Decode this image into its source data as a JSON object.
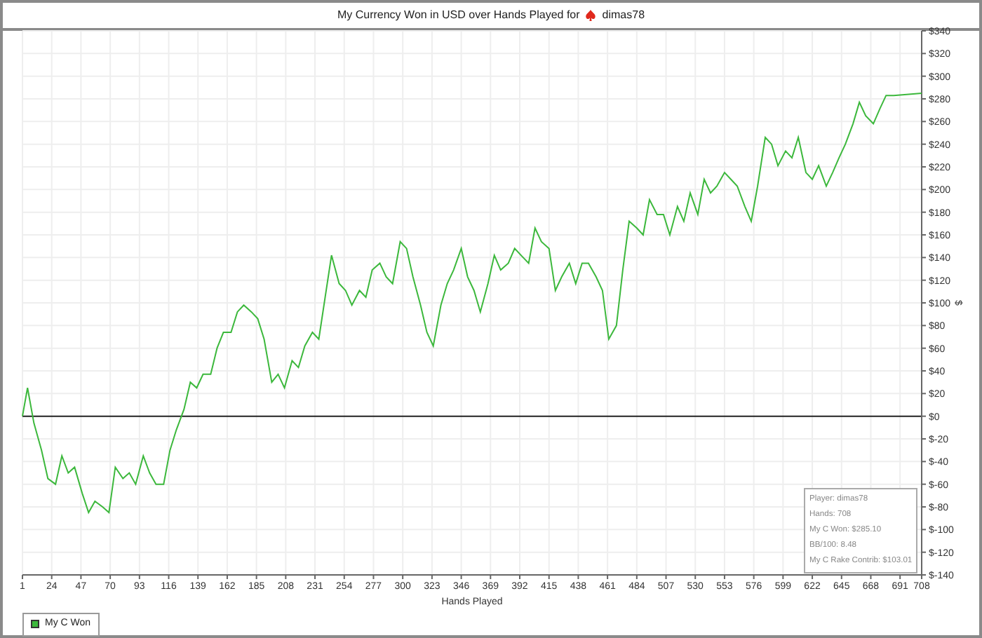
{
  "title_bar": {
    "text": "My Currency Won in USD over Hands Played for",
    "player": "dimas78"
  },
  "chart": {
    "chart_data": {
      "type": "line",
      "grid": true,
      "xlabel": "Hands Played",
      "ylabel": "$",
      "x": [
        1,
        5,
        10,
        16,
        21,
        27,
        32,
        37,
        42,
        48,
        53,
        58,
        64,
        69,
        74,
        80,
        85,
        90,
        96,
        101,
        106,
        112,
        117,
        122,
        128,
        133,
        138,
        143,
        149,
        154,
        159,
        165,
        170,
        175,
        181,
        186,
        191,
        197,
        202,
        207,
        213,
        218,
        223,
        229,
        234,
        239,
        244,
        250,
        255,
        260,
        266,
        271,
        276,
        282,
        287,
        292,
        298,
        303,
        308,
        314,
        319,
        324,
        330,
        335,
        340,
        346,
        351,
        356,
        361,
        367,
        372,
        377,
        383,
        388,
        393,
        399,
        404,
        409,
        415,
        420,
        425,
        431,
        436,
        441,
        446,
        452,
        457,
        462,
        468,
        473,
        478,
        484,
        489,
        494,
        500,
        505,
        510,
        516,
        521,
        526,
        532,
        537,
        542,
        547,
        553,
        558,
        563,
        569,
        574,
        579,
        585,
        590,
        595,
        601,
        606,
        611,
        617,
        622,
        627,
        633,
        638,
        643,
        648,
        654,
        659,
        664,
        670,
        675,
        680,
        686,
        708
      ],
      "series": [
        {
          "name": "My C Won",
          "color": "#3cb83c",
          "values": [
            0,
            25,
            -6,
            -30,
            -55,
            -60,
            -35,
            -50,
            -45,
            -68,
            -85,
            -75,
            -80,
            -85,
            -45,
            -55,
            -50,
            -60,
            -35,
            -50,
            -60,
            -60,
            -30,
            -12,
            6,
            30,
            25,
            37,
            37,
            60,
            74,
            74,
            92,
            98,
            92,
            86,
            68,
            30,
            37,
            25,
            49,
            43,
            62,
            74,
            68,
            105,
            142,
            117,
            111,
            98,
            111,
            105,
            129,
            135,
            123,
            117,
            154,
            148,
            123,
            98,
            74,
            62,
            98,
            117,
            129,
            148,
            123,
            111,
            92,
            117,
            142,
            129,
            135,
            148,
            142,
            135,
            166,
            154,
            148,
            111,
            123,
            135,
            117,
            135,
            135,
            123,
            111,
            68,
            80,
            129,
            172,
            166,
            160,
            191,
            178,
            178,
            160,
            185,
            172,
            197,
            178,
            209,
            197,
            203,
            215,
            209,
            203,
            185,
            172,
            203,
            246,
            240,
            221,
            234,
            228,
            246,
            215,
            209,
            221,
            203,
            215,
            228,
            240,
            258,
            277,
            265,
            258,
            271,
            283,
            283,
            285
          ]
        }
      ],
      "xlim": [
        1,
        708
      ],
      "ylim": [
        -140,
        340
      ],
      "xticks": [
        1,
        24,
        47,
        70,
        93,
        116,
        139,
        162,
        185,
        208,
        231,
        254,
        277,
        300,
        323,
        346,
        369,
        392,
        415,
        438,
        461,
        484,
        507,
        530,
        553,
        576,
        599,
        622,
        645,
        668,
        691,
        708
      ],
      "yticks": [
        {
          "value": 340,
          "label": "$340"
        },
        {
          "value": 320,
          "label": "$320"
        },
        {
          "value": 300,
          "label": "$300"
        },
        {
          "value": 280,
          "label": "$280"
        },
        {
          "value": 260,
          "label": "$260"
        },
        {
          "value": 240,
          "label": "$240"
        },
        {
          "value": 220,
          "label": "$220"
        },
        {
          "value": 200,
          "label": "$200"
        },
        {
          "value": 180,
          "label": "$180"
        },
        {
          "value": 160,
          "label": "$160"
        },
        {
          "value": 140,
          "label": "$140"
        },
        {
          "value": 120,
          "label": "$120"
        },
        {
          "value": 100,
          "label": "$100"
        },
        {
          "value": 80,
          "label": "$80"
        },
        {
          "value": 60,
          "label": "$60"
        },
        {
          "value": 40,
          "label": "$40"
        },
        {
          "value": 20,
          "label": "$20"
        },
        {
          "value": 0,
          "label": "$0"
        },
        {
          "value": -20,
          "label": "$-20"
        },
        {
          "value": -40,
          "label": "$-40"
        },
        {
          "value": -60,
          "label": "$-60"
        },
        {
          "value": -80,
          "label": "$-80"
        },
        {
          "value": -100,
          "label": "$-100"
        },
        {
          "value": -120,
          "label": "$-120"
        },
        {
          "value": -140,
          "label": "$-140"
        }
      ]
    },
    "tooltip": [
      "Player: dimas78",
      "Hands: 708",
      "My C Won: $285.10",
      "BB/100: 8.48",
      "My C Rake Contrib: $103.01"
    ]
  }
}
